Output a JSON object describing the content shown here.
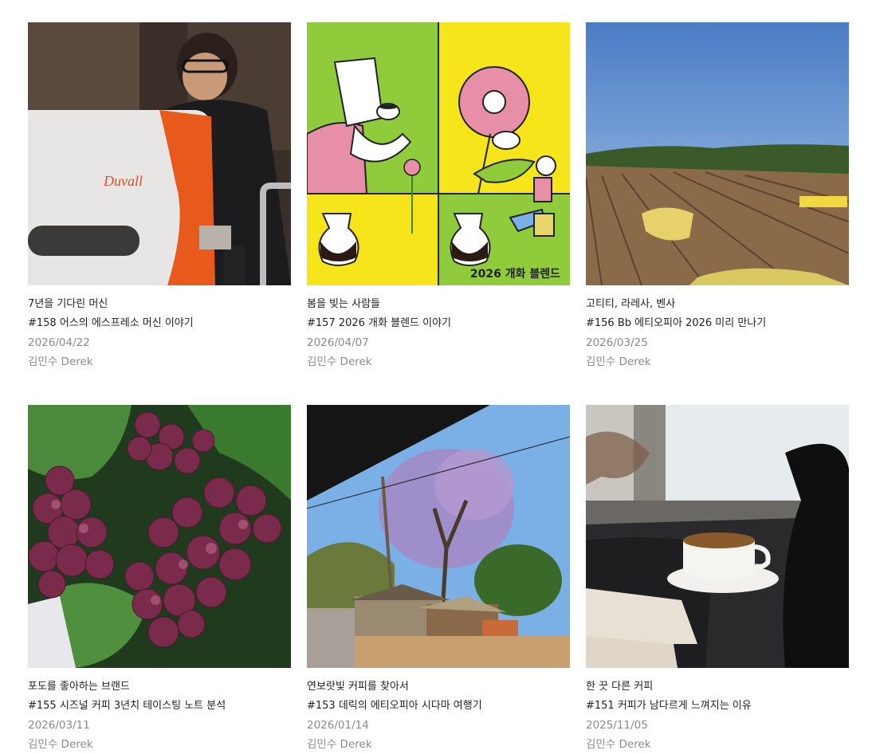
{
  "posts": [
    {
      "subtitle": "7년을 기다린 머신",
      "title": "#158 어스의 에스프레소 머신 이야기",
      "date": "2026/04/22",
      "author": "김민수 Derek",
      "image_text": "Duvall"
    },
    {
      "subtitle": "봄을 빚는 사람들",
      "title": "#157 2026 개화 블렌드 이야기",
      "date": "2026/04/07",
      "author": "김민수 Derek",
      "image_text": "2026 개화 블렌드"
    },
    {
      "subtitle": "고티티, 라레사, 벤사",
      "title": "#156 Bb 에티오피아 2026 미리 만나기",
      "date": "2026/03/25",
      "author": "김민수 Derek"
    },
    {
      "subtitle": "포도를 좋아하는 브랜드",
      "title": "#155 시즈널 커피 3년치 테이스팅 노트 분석",
      "date": "2026/03/11",
      "author": "김민수 Derek"
    },
    {
      "subtitle": "연보랏빛 커피를 찾아서",
      "title": "#153 데릭의 에티오피아 시다마 여행기",
      "date": "2026/01/14",
      "author": "김민수 Derek"
    },
    {
      "subtitle": "한 끗 다른 커피",
      "title": "#151 커피가 남다르게 느껴지는 이유",
      "date": "2025/11/05",
      "author": "김민수 Derek"
    }
  ]
}
